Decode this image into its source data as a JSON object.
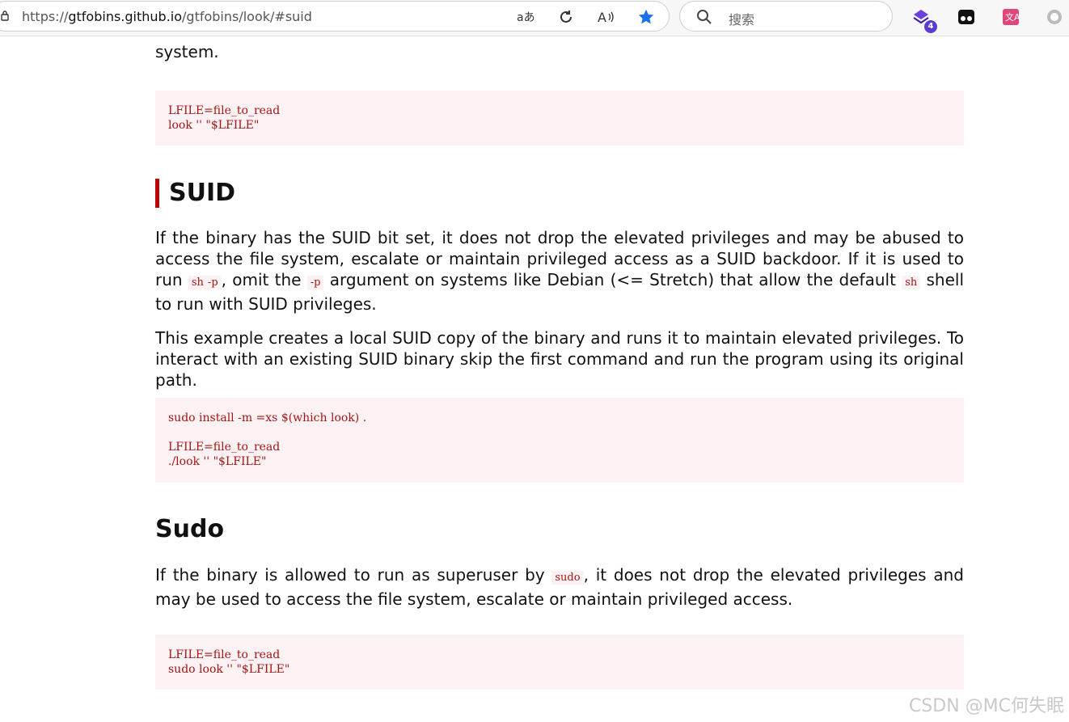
{
  "browser": {
    "url_scheme": "https://",
    "url_host": "gtfobins.github.io",
    "url_path": "/gtfobins/look/#suid",
    "search_placeholder": "搜索",
    "extension_badge": "4"
  },
  "page": {
    "top_para_tail": "system.",
    "code_top": [
      "LFILE=file_to_read",
      "look '' \"$LFILE\""
    ],
    "suid_heading": "SUID",
    "suid_p1": {
      "t1": "If the binary has the SUID bit set, it does not drop the elevated privileges and may be abused to access the file system, escalate or maintain privileged access as a SUID backdoor. If it is used to run ",
      "c1": "sh -p",
      "t2": ", omit the ",
      "c2": "-p",
      "t3": " argument on systems like Debian (<= Stretch) that allow the default ",
      "c3": "sh",
      "t4": " shell to run with SUID privileges."
    },
    "suid_p2": "This example creates a local SUID copy of the binary and runs it to maintain elevated privileges. To interact with an existing SUID binary skip the first command and run the program using its original path.",
    "code_suid": [
      "sudo install -m =xs $(which look) .",
      "",
      "LFILE=file_to_read",
      "./look '' \"$LFILE\""
    ],
    "sudo_heading": "Sudo",
    "sudo_p": {
      "t1": "If the binary is allowed to run as superuser by ",
      "c1": "sudo",
      "t2": ", it does not drop the elevated privileges and may be used to access the file system, escalate or maintain privileged access."
    },
    "code_sudo": [
      "LFILE=file_to_read",
      "sudo look '' \"$LFILE\""
    ]
  },
  "watermark": "CSDN @MC何失眠",
  "colors": {
    "accent_bar": "#c00000",
    "code_bg": "#fdf2f3",
    "code_text": "#a31515"
  },
  "icons": [
    "lock-icon",
    "translate-icon",
    "refresh-icon",
    "read-aloud-icon",
    "favorite-star-icon",
    "search-icon",
    "extension-icon",
    "tampermonkey-icon",
    "translator-icon",
    "circle-icon"
  ]
}
